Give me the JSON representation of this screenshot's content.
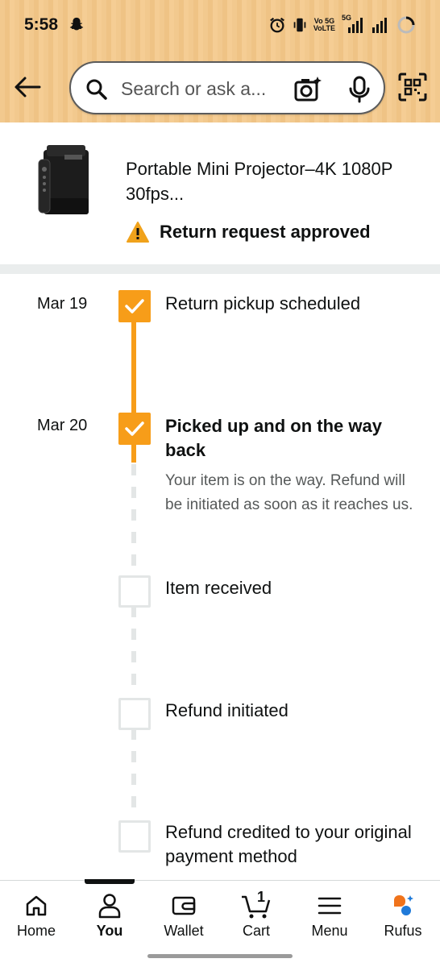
{
  "status_bar": {
    "time": "5:58",
    "network_label_top": "Vo 5G",
    "network_label_bottom": "VoLTE",
    "network_5g": "5G"
  },
  "search": {
    "placeholder": "Search or ask a..."
  },
  "product": {
    "title": "Portable Mini Projector–4K 1080P 30fps...",
    "return_status": "Return request approved"
  },
  "timeline": [
    {
      "date": "Mar 19",
      "title": "Return pickup scheduled",
      "completed": true
    },
    {
      "date": "Mar 20",
      "title": "Picked up and on the way back",
      "description": "Your item is on the way. Refund will be initiated as soon as it reaches us.",
      "completed": true
    },
    {
      "date": "",
      "title": "Item received",
      "completed": false
    },
    {
      "date": "",
      "title": "Refund initiated",
      "completed": false
    },
    {
      "date": "",
      "title": "Refund credited to your original payment method",
      "completed": false
    }
  ],
  "bottom_nav": {
    "items": [
      {
        "label": "Home",
        "icon": "home-icon"
      },
      {
        "label": "You",
        "icon": "person-icon",
        "active": true
      },
      {
        "label": "Wallet",
        "icon": "wallet-icon"
      },
      {
        "label": "Cart",
        "icon": "cart-icon",
        "badge": "1"
      },
      {
        "label": "Menu",
        "icon": "menu-icon"
      },
      {
        "label": "Rufus",
        "icon": "rufus-icon"
      }
    ]
  },
  "colors": {
    "accent": "#f79d19",
    "header_bg": "#f2c98e",
    "warning": "#f0a21b"
  }
}
